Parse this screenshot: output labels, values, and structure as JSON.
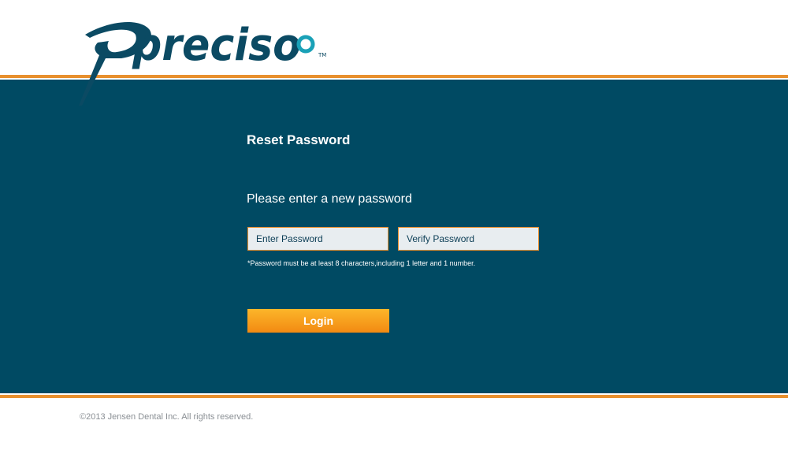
{
  "brand": {
    "logo_text": "preciso",
    "trademark": "TM",
    "colors": {
      "primary": "#004a63",
      "accent": "#e8902e",
      "button_top": "#fcb62a",
      "button_bottom": "#f28a12"
    }
  },
  "form": {
    "title": "Reset Password",
    "instruction": "Please enter a new password",
    "password_placeholder": "Enter Password",
    "verify_placeholder": "Verify Password",
    "hint": "*Password must be at least 8 characters,including 1 letter and 1 number.",
    "submit_label": "Login"
  },
  "footer": {
    "copyright": "©2013 Jensen Dental Inc. All rights reserved."
  }
}
